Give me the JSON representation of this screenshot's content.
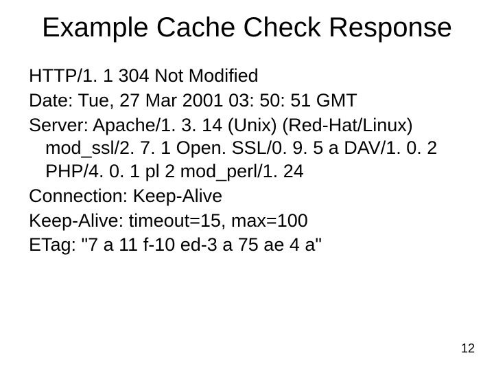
{
  "slide": {
    "title": "Example Cache Check Response",
    "lines": [
      "HTTP/1. 1 304 Not Modified",
      "Date: Tue, 27 Mar 2001 03: 50: 51 GMT",
      "Server: Apache/1. 3. 14 (Unix)  (Red-Hat/Linux) mod_ssl/2. 7. 1 Open. SSL/0. 9. 5 a DAV/1. 0. 2 PHP/4. 0. 1 pl 2 mod_perl/1. 24",
      "Connection: Keep-Alive",
      "Keep-Alive: timeout=15, max=100",
      "ETag: \"7 a 11 f-10 ed-3 a 75 ae 4 a\""
    ],
    "page_number": "12"
  }
}
